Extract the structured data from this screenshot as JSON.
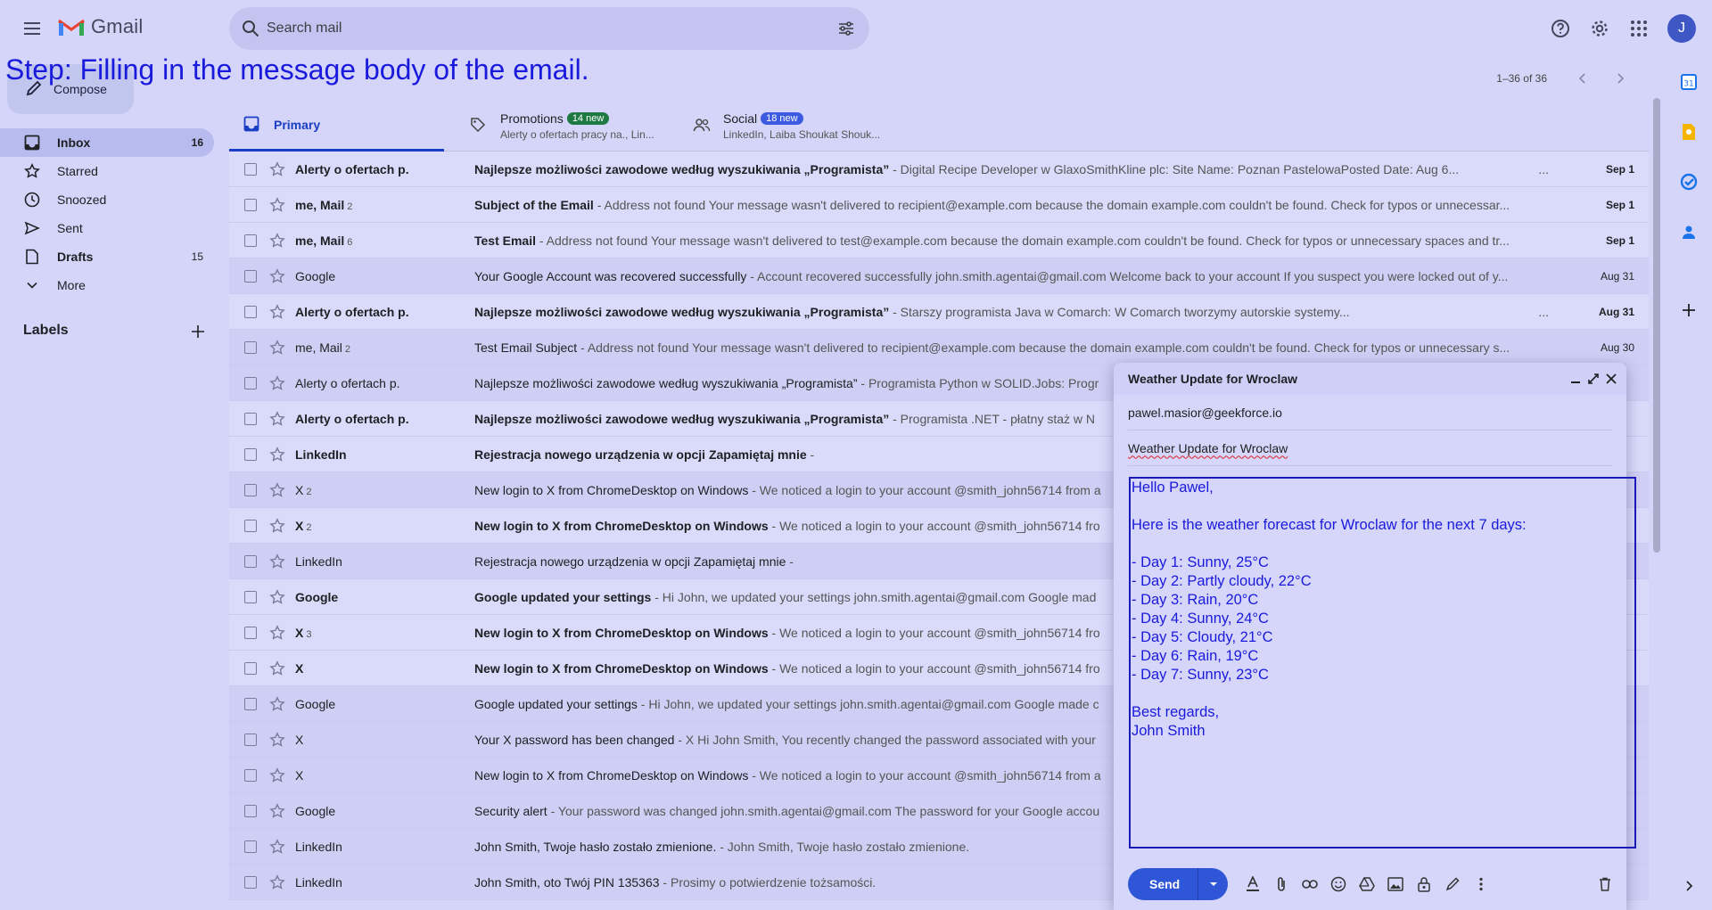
{
  "step_caption": "Step: Filling in the message body of the email.",
  "header": {
    "app_name": "Gmail",
    "search_placeholder": "Search mail",
    "avatar_letter": "J"
  },
  "sidebar": {
    "compose_label": "Compose",
    "items": [
      {
        "label": "Inbox",
        "count": "16",
        "icon": "inbox-icon"
      },
      {
        "label": "Starred",
        "count": "",
        "icon": "star-icon"
      },
      {
        "label": "Snoozed",
        "count": "",
        "icon": "clock-icon"
      },
      {
        "label": "Sent",
        "count": "",
        "icon": "send-icon"
      },
      {
        "label": "Drafts",
        "count": "15",
        "icon": "draft-icon"
      },
      {
        "label": "More",
        "count": "",
        "icon": "chevron-down-icon"
      }
    ],
    "labels_heading": "Labels"
  },
  "toolbar": {
    "pager": "1–36 of 36"
  },
  "tabs": {
    "primary": "Primary",
    "promotions": {
      "label": "Promotions",
      "badge": "14 new",
      "sub": "Alerty o ofertach pracy na., Lin..."
    },
    "social": {
      "label": "Social",
      "badge": "18 new",
      "sub": "LinkedIn, Laiba Shoukat Shouk..."
    }
  },
  "emails": [
    {
      "sender": "Alerty o ofertach p.",
      "count": "",
      "subject": "Najlepsze możliwości zawodowe według wyszukiwania „Programista”",
      "snippet": " - Digital Recipe Developer w GlaxoSmithKline plc: Site Name: Poznan PastelowaPosted Date: Aug 6...",
      "date": "Sep 1",
      "unread": true,
      "ellipsis": "..."
    },
    {
      "sender": "me, Mail",
      "count": "2",
      "subject": "Subject of the Email",
      "snippet": " - Address not found Your message wasn't delivered to recipient@example.com because the domain example.com couldn't be found. Check for typos or unnecessar...",
      "date": "Sep 1",
      "unread": true,
      "ellipsis": ""
    },
    {
      "sender": "me, Mail",
      "count": "6",
      "subject": "Test Email",
      "snippet": " - Address not found Your message wasn't delivered to test@example.com because the domain example.com couldn't be found. Check for typos or unnecessary spaces and tr...",
      "date": "Sep 1",
      "unread": true,
      "ellipsis": ""
    },
    {
      "sender": "Google",
      "count": "",
      "subject": "Your Google Account was recovered successfully",
      "snippet": " - Account recovered successfully john.smith.agentai@gmail.com Welcome back to your account If you suspect you were locked out of y...",
      "date": "Aug 31",
      "unread": false,
      "ellipsis": ""
    },
    {
      "sender": "Alerty o ofertach p.",
      "count": "",
      "subject": "Najlepsze możliwości zawodowe według wyszukiwania „Programista”",
      "snippet": " - Starszy programista Java w Comarch: W Comarch tworzymy autorskie systemy...",
      "date": "Aug 31",
      "unread": true,
      "ellipsis": "..."
    },
    {
      "sender": "me, Mail",
      "count": "2",
      "subject": "Test Email Subject",
      "snippet": " - Address not found Your message wasn't delivered to recipient@example.com because the domain example.com couldn't be found. Check for typos or unnecessary s...",
      "date": "Aug 30",
      "unread": false,
      "ellipsis": ""
    },
    {
      "sender": "Alerty o ofertach p.",
      "count": "",
      "subject": "Najlepsze możliwości zawodowe według wyszukiwania „Programista”",
      "snippet": " - Programista Python w SOLID.Jobs: Progr",
      "date": "",
      "unread": false,
      "ellipsis": ""
    },
    {
      "sender": "Alerty o ofertach p.",
      "count": "",
      "subject": "Najlepsze możliwości zawodowe według wyszukiwania „Programista”",
      "snippet": " - Programista .NET - płatny staż w N",
      "date": "",
      "unread": true,
      "ellipsis": ""
    },
    {
      "sender": "LinkedIn",
      "count": "",
      "subject": "Rejestracja nowego urządzenia w opcji Zapamiętaj mnie",
      "snippet": " -",
      "date": "",
      "unread": true,
      "ellipsis": ""
    },
    {
      "sender": "X",
      "count": "2",
      "subject": "New login to X from ChromeDesktop on Windows",
      "snippet": " - We noticed a login to your account @smith_john56714 from a",
      "date": "",
      "unread": false,
      "ellipsis": ""
    },
    {
      "sender": "X",
      "count": "2",
      "subject": "New login to X from ChromeDesktop on Windows",
      "snippet": " - We noticed a login to your account @smith_john56714 fro",
      "date": "",
      "unread": true,
      "ellipsis": ""
    },
    {
      "sender": "LinkedIn",
      "count": "",
      "subject": "Rejestracja nowego urządzenia w opcji Zapamiętaj mnie",
      "snippet": " -",
      "date": "",
      "unread": false,
      "ellipsis": ""
    },
    {
      "sender": "Google",
      "count": "",
      "subject": "Google updated your settings",
      "snippet": " - Hi John, we updated your settings john.smith.agentai@gmail.com Google mad",
      "date": "",
      "unread": true,
      "ellipsis": ""
    },
    {
      "sender": "X",
      "count": "3",
      "subject": "New login to X from ChromeDesktop on Windows",
      "snippet": " - We noticed a login to your account @smith_john56714 fro",
      "date": "",
      "unread": true,
      "ellipsis": ""
    },
    {
      "sender": "X",
      "count": "",
      "subject": "New login to X from ChromeDesktop on Windows",
      "snippet": " - We noticed a login to your account @smith_john56714 fro",
      "date": "",
      "unread": true,
      "ellipsis": ""
    },
    {
      "sender": "Google",
      "count": "",
      "subject": "Google updated your settings",
      "snippet": " - Hi John, we updated your settings john.smith.agentai@gmail.com Google made c",
      "date": "",
      "unread": false,
      "ellipsis": ""
    },
    {
      "sender": "X",
      "count": "",
      "subject": "Your X password has been changed",
      "snippet": " - X Hi John Smith, You recently changed the password associated with your",
      "date": "",
      "unread": false,
      "ellipsis": ""
    },
    {
      "sender": "X",
      "count": "",
      "subject": "New login to X from ChromeDesktop on Windows",
      "snippet": " - We noticed a login to your account @smith_john56714 from a",
      "date": "",
      "unread": false,
      "ellipsis": ""
    },
    {
      "sender": "Google",
      "count": "",
      "subject": "Security alert",
      "snippet": " - Your password was changed john.smith.agentai@gmail.com The password for your Google accou",
      "date": "",
      "unread": false,
      "ellipsis": ""
    },
    {
      "sender": "LinkedIn",
      "count": "",
      "subject": "John Smith, Twoje hasło zostało zmienione.",
      "snippet": " - John Smith, Twoje hasło zostało zmienione.",
      "date": "",
      "unread": false,
      "ellipsis": ""
    },
    {
      "sender": "LinkedIn",
      "count": "",
      "subject": "John Smith, oto Twój PIN 135363",
      "snippet": " - Prosimy o potwierdzenie tożsamości.",
      "date": "",
      "unread": false,
      "ellipsis": ""
    }
  ],
  "compose": {
    "title": "Weather Update for Wroclaw",
    "to": "pawel.masior@geekforce.io",
    "subject": "Weather Update for Wroclaw",
    "body_lines": [
      "Hello Pawel,",
      "",
      "Here is the weather forecast for Wroclaw for the next 7 days:",
      "",
      "- Day 1: Sunny, 25°C",
      "- Day 2: Partly cloudy, 22°C",
      "- Day 3: Rain, 20°C",
      "- Day 4: Sunny, 24°C",
      "- Day 5: Cloudy, 21°C",
      "- Day 6: Rain, 19°C",
      "- Day 7: Sunny, 23°C",
      "",
      "Best regards,",
      "John Smith"
    ],
    "send_label": "Send"
  },
  "colors": {
    "accent": "#2f56d6",
    "caption": "#1a1adc",
    "background": "#d5d5f9"
  }
}
